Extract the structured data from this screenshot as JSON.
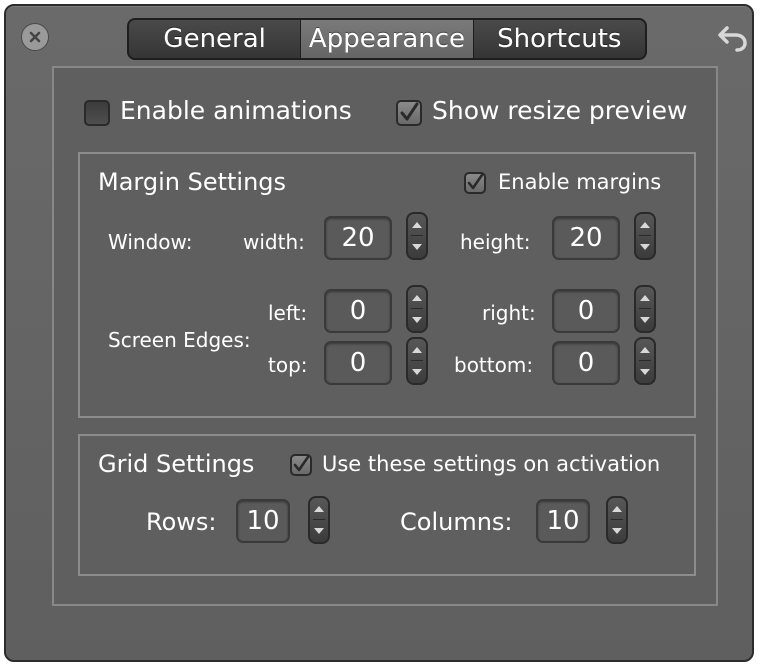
{
  "tabs": [
    "General",
    "Appearance",
    "Shortcuts"
  ],
  "selected_tab": "Appearance",
  "options": {
    "enable_animations": {
      "label": "Enable animations",
      "checked": false
    },
    "show_resize_preview": {
      "label": "Show resize preview",
      "checked": true
    }
  },
  "margins": {
    "title": "Margin Settings",
    "enable": {
      "label": "Enable margins",
      "checked": true
    },
    "window_label": "Window:",
    "width_label": "width:",
    "width_value": "20",
    "height_label": "height:",
    "height_value": "20",
    "edges_label": "Screen Edges:",
    "left_label": "left:",
    "left_value": "0",
    "right_label": "right:",
    "right_value": "0",
    "top_label": "top:",
    "top_value": "0",
    "bottom_label": "bottom:",
    "bottom_value": "0"
  },
  "grid": {
    "title": "Grid Settings",
    "use_on_activation": {
      "label": "Use these settings on activation",
      "checked": true
    },
    "rows_label": "Rows:",
    "rows_value": "10",
    "columns_label": "Columns:",
    "columns_value": "10"
  },
  "icons": {
    "close": "close-icon",
    "undo": "undo-icon",
    "checkmark": "checkmark-icon",
    "stepper_up": "arrow-up-icon",
    "stepper_down": "arrow-down-icon"
  }
}
